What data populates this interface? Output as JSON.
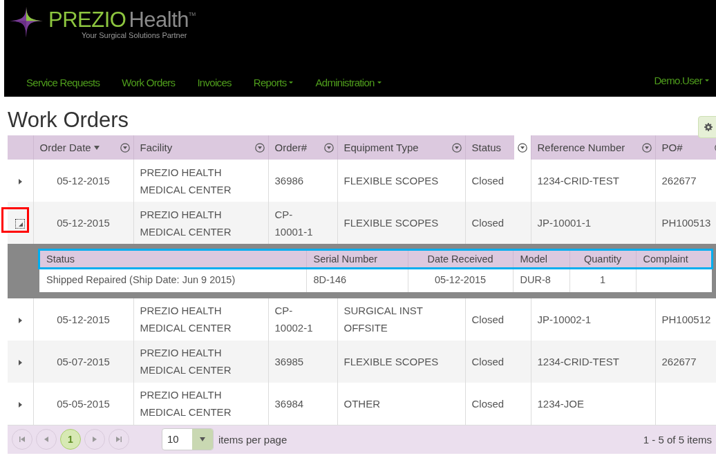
{
  "brand": {
    "name_primary": "PREZIO",
    "name_secondary": "Health",
    "trademark": "TM",
    "tagline": "Your Surgical Solutions Partner"
  },
  "nav": [
    {
      "label": "Service Requests",
      "has_menu": false
    },
    {
      "label": "Work Orders",
      "has_menu": false
    },
    {
      "label": "Invoices",
      "has_menu": false
    },
    {
      "label": "Reports",
      "has_menu": true
    },
    {
      "label": "Administration",
      "has_menu": true
    }
  ],
  "user_menu": {
    "label": "Demo.User",
    "has_menu": true
  },
  "page_title": "Work Orders",
  "table": {
    "columns": [
      {
        "label": "Order Date",
        "sorted": true,
        "filtered": false
      },
      {
        "label": "Facility",
        "sorted": false,
        "filtered": false
      },
      {
        "label": "Order#",
        "sorted": false,
        "filtered": false
      },
      {
        "label": "Equipment Type",
        "sorted": false,
        "filtered": false
      },
      {
        "label": "Status",
        "sorted": false,
        "filtered": true
      },
      {
        "label": "Reference Number",
        "sorted": false,
        "filtered": false
      },
      {
        "label": "PO#",
        "sorted": false,
        "filtered": false
      }
    ],
    "rows": [
      {
        "expanded": false,
        "cells": [
          "05-12-2015",
          "PREZIO HEALTH MEDICAL CENTER",
          "36986",
          "FLEXIBLE SCOPES",
          "Closed",
          "1234-CRID-TEST",
          "262677"
        ]
      },
      {
        "expanded": true,
        "cells": [
          "05-12-2015",
          "PREZIO HEALTH MEDICAL CENTER",
          "CP-10001-1",
          "FLEXIBLE SCOPES",
          "Closed",
          "JP-10001-1",
          "PH100513"
        ],
        "detail": {
          "columns": [
            {
              "label": "Status"
            },
            {
              "label": "Serial Number"
            },
            {
              "label": "Date Received"
            },
            {
              "label": "Model"
            },
            {
              "label": "Quantity"
            },
            {
              "label": "Complaint"
            }
          ],
          "rows": [
            [
              "Shipped Repaired (Ship Date: Jun 9 2015)",
              "8D-146",
              "05-12-2015",
              "DUR-8",
              "1",
              ""
            ]
          ]
        }
      },
      {
        "expanded": false,
        "cells": [
          "05-12-2015",
          "PREZIO HEALTH MEDICAL CENTER",
          "CP-10002-1",
          "SURGICAL INST OFFSITE",
          "Closed",
          "JP-10002-1",
          "PH100512"
        ]
      },
      {
        "expanded": false,
        "cells": [
          "05-07-2015",
          "PREZIO HEALTH MEDICAL CENTER",
          "36985",
          "FLEXIBLE SCOPES",
          "Closed",
          "1234-CRID-TEST",
          "262677"
        ]
      },
      {
        "expanded": false,
        "cells": [
          "05-05-2015",
          "PREZIO HEALTH MEDICAL CENTER",
          "36984",
          "OTHER",
          "Closed",
          "1234-JOE",
          ""
        ]
      }
    ]
  },
  "pager": {
    "pages": [
      {
        "label": "1",
        "selected": true
      }
    ],
    "page_size": "10",
    "page_size_label": "items per page",
    "summary": "1 - 5 of 5 items"
  }
}
